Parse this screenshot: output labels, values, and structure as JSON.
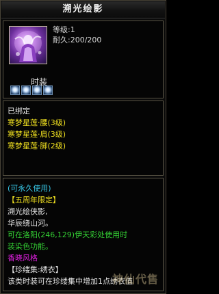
{
  "item": {
    "title": "溯光绘影",
    "level": "等级:1",
    "durability": "耐久:200/200",
    "category": "时装"
  },
  "bound": {
    "status": "已绑定",
    "set_pieces": [
      "寒梦星莲·腰(3级)",
      "寒梦星莲·肩(3级)",
      "寒梦星莲·脚(2级)"
    ]
  },
  "description": {
    "usage": "(可永久使用)",
    "event": "【五周年限定】",
    "flavor_line1": "溯光绘侠影,",
    "flavor_line2": "华辰绕山河。",
    "dye_line1": "可在洛阳(246,129)伊天彩处使用时",
    "dye_line2": "装染色功能。",
    "style": "香晓风格",
    "collection": "【珍缕集:绣衣】",
    "collection_note": "该类时装可在珍缕集中增加1点绣衣值"
  },
  "watermark": "神仙代售",
  "colors": {
    "white": "#e6e6e6",
    "yellow": "#f0e020",
    "cyan": "#38c8e8",
    "green": "#34d034",
    "magenta": "#e020e0"
  }
}
